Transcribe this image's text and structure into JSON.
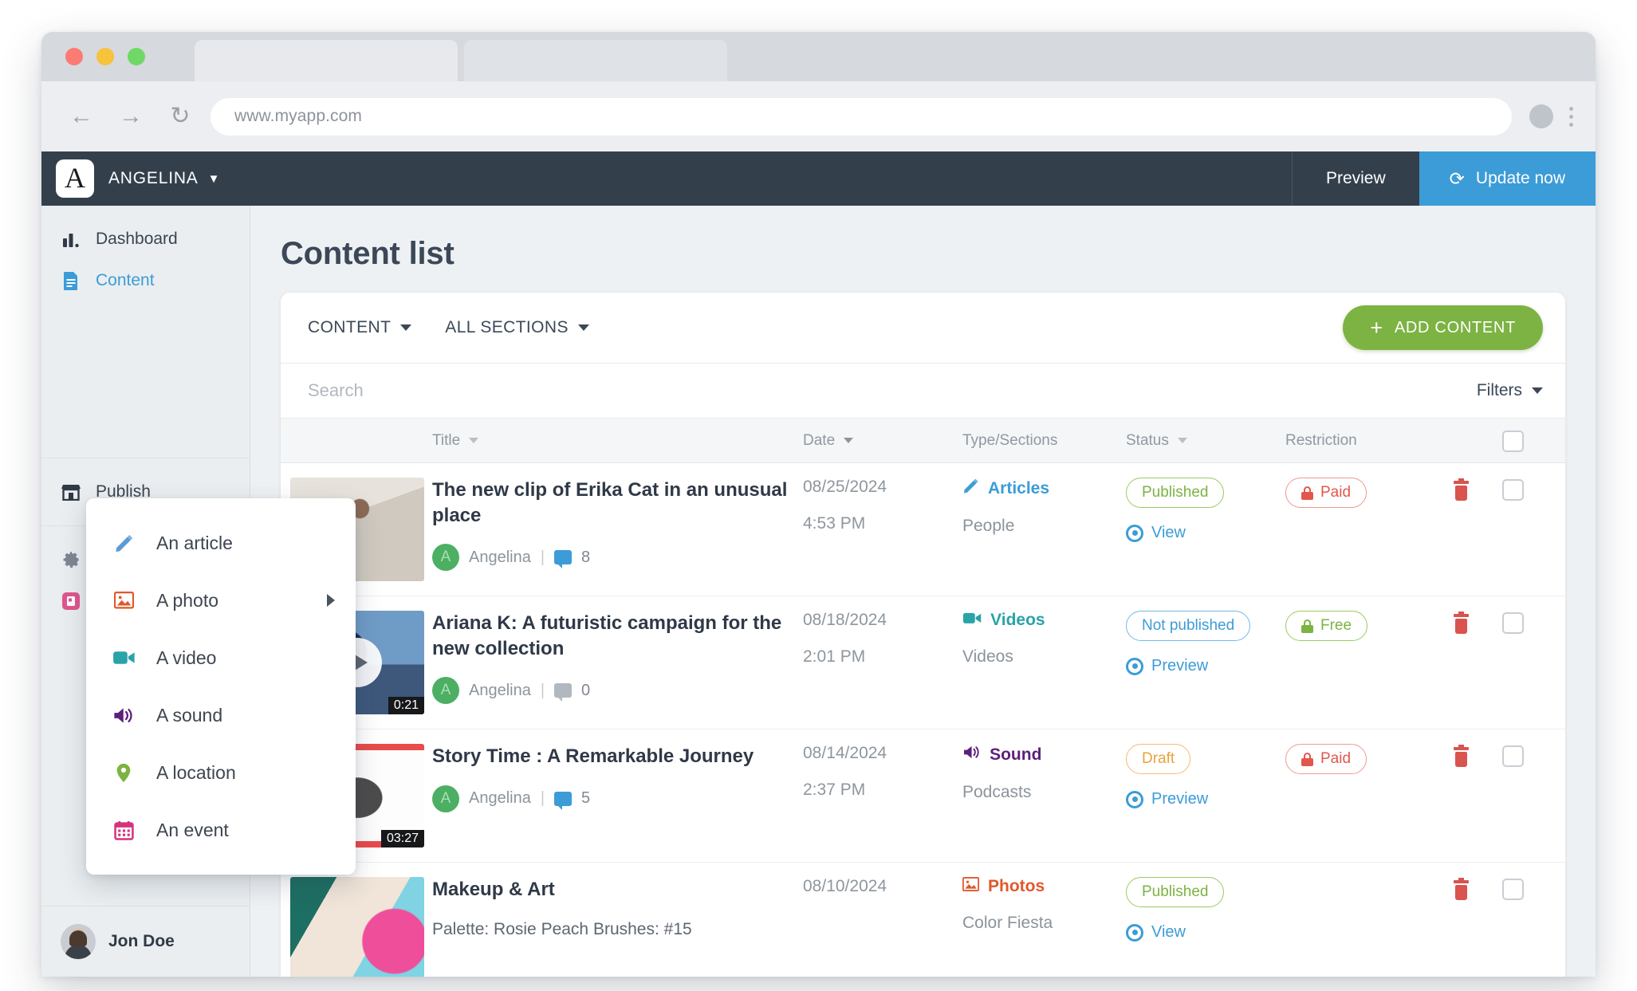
{
  "browser": {
    "url": "www.myapp.com",
    "back_icon": "arrow-left-icon",
    "forward_icon": "arrow-right-icon",
    "reload_icon": "reload-icon"
  },
  "topbar": {
    "logo_letter": "A",
    "brand_name": "ANGELINA",
    "preview_label": "Preview",
    "update_label": "Update now",
    "update_bg": "#3c9cd7"
  },
  "sidebar": {
    "items": [
      {
        "label": "Dashboard",
        "icon": "bar-chart-icon",
        "state": "default"
      },
      {
        "label": "Content",
        "icon": "document-icon",
        "state": "active"
      },
      {
        "label": "Publish",
        "icon": "store-icon",
        "state": "default"
      },
      {
        "label": "Settings",
        "icon": "gear-icon",
        "state": "muted"
      },
      {
        "label": "Extensions Store",
        "icon": "extensions-icon",
        "state": "ext"
      }
    ],
    "user": {
      "name": "Jon Doe"
    }
  },
  "content_type_menu": {
    "items": [
      {
        "label": "An article",
        "icon": "pencil-icon",
        "color": "#5b9bd5",
        "submenu": false
      },
      {
        "label": "A photo",
        "icon": "photo-icon",
        "color": "#e0582c",
        "submenu": true
      },
      {
        "label": "A video",
        "icon": "video-camera-icon",
        "color": "#2aa3a8",
        "submenu": false
      },
      {
        "label": "A sound",
        "icon": "speaker-icon",
        "color": "#5c1f7a",
        "submenu": false
      },
      {
        "label": "A location",
        "icon": "map-pin-icon",
        "color": "#7cb342",
        "submenu": false
      },
      {
        "label": "An event",
        "icon": "calendar-icon",
        "color": "#d6327c",
        "submenu": false
      }
    ]
  },
  "main": {
    "page_title": "Content list",
    "toolbar": {
      "content_filter": "CONTENT",
      "sections_filter": "ALL SECTIONS",
      "add_content_label": "ADD CONTENT",
      "add_content_plus": "+",
      "add_content_bg": "#7cb342"
    },
    "search": {
      "placeholder": "Search",
      "value": "",
      "filters_label": "Filters"
    },
    "table": {
      "headers": {
        "title": "Title",
        "date": "Date",
        "type_sections": "Type/Sections",
        "status": "Status",
        "restriction": "Restriction"
      },
      "rows": [
        {
          "title": "The new clip of Erika Cat in an unusual place",
          "subtitle": "",
          "author": "Angelina",
          "author_initial": "A",
          "comments": "8",
          "comments_color": "blue",
          "date": "08/25/2024",
          "time": "4:53 PM",
          "type": "Articles",
          "type_icon": "pencil-icon",
          "type_color": "#3c9cd7",
          "section": "People",
          "status": "Published",
          "status_style": "green",
          "action": "View",
          "restriction": "Paid",
          "restriction_style": "red",
          "thumb_art": "art-1",
          "thumb_duration": "",
          "thumb_play": false
        },
        {
          "title": "Ariana K: A futuristic campaign for the new collection",
          "subtitle": "",
          "author": "Angelina",
          "author_initial": "A",
          "comments": "0",
          "comments_color": "grey",
          "date": "08/18/2024",
          "time": "2:01 PM",
          "type": "Videos",
          "type_icon": "video-camera-icon",
          "type_color": "#2aa3a8",
          "section": "Videos",
          "status": "Not published",
          "status_style": "blue",
          "action": "Preview",
          "restriction": "Free",
          "restriction_style": "green",
          "thumb_art": "art-2",
          "thumb_duration": "0:21",
          "thumb_play": true
        },
        {
          "title": "Story Time : A Remarkable Journey",
          "subtitle": "",
          "author": "Angelina",
          "author_initial": "A",
          "comments": "5",
          "comments_color": "blue",
          "date": "08/14/2024",
          "time": "2:37 PM",
          "type": "Sound",
          "type_icon": "speaker-icon",
          "type_color": "#5c1f7a",
          "section": "Podcasts",
          "status": "Draft",
          "status_style": "orange",
          "action": "Preview",
          "restriction": "Paid",
          "restriction_style": "red",
          "thumb_art": "art-3",
          "thumb_duration": "03:27",
          "thumb_play": false
        },
        {
          "title": "Makeup & Art",
          "subtitle": "Palette: Rosie Peach Brushes: #15",
          "author": "",
          "author_initial": "",
          "comments": "",
          "comments_color": "",
          "date": "08/10/2024",
          "time": "",
          "type": "Photos",
          "type_icon": "photo-icon",
          "type_color": "#e0582c",
          "section": "Color Fiesta",
          "status": "Published",
          "status_style": "green",
          "action": "View",
          "restriction": "",
          "restriction_style": "",
          "thumb_art": "art-4",
          "thumb_duration": "",
          "thumb_play": false
        }
      ]
    }
  }
}
